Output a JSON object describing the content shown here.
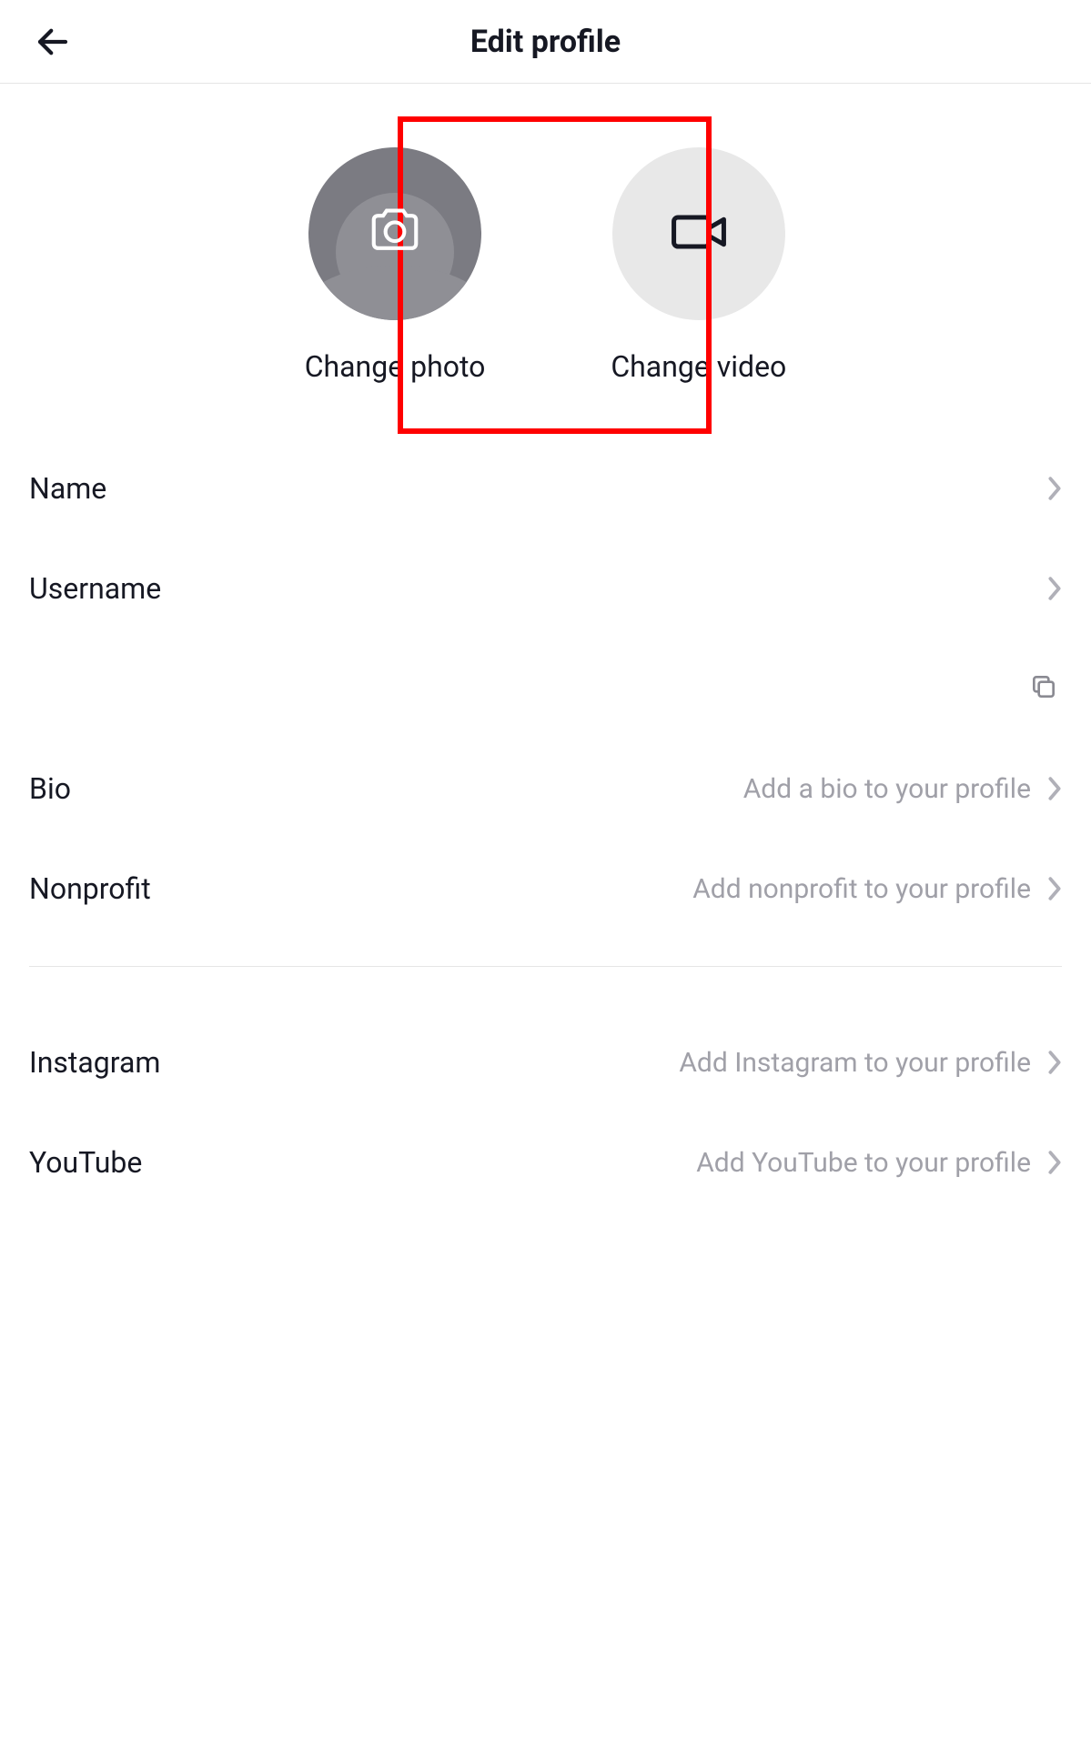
{
  "header": {
    "title": "Edit profile"
  },
  "avatars": {
    "photo_label": "Change photo",
    "video_label": "Change video"
  },
  "rows": {
    "name": {
      "label": "Name",
      "placeholder": ""
    },
    "username": {
      "label": "Username",
      "placeholder": ""
    },
    "bio": {
      "label": "Bio",
      "placeholder": "Add a bio to your profile"
    },
    "nonprofit": {
      "label": "Nonprofit",
      "placeholder": "Add nonprofit to your profile"
    },
    "instagram": {
      "label": "Instagram",
      "placeholder": "Add Instagram to your profile"
    },
    "youtube": {
      "label": "YouTube",
      "placeholder": "Add YouTube to your profile"
    }
  },
  "highlight": {
    "target": "change-video"
  }
}
